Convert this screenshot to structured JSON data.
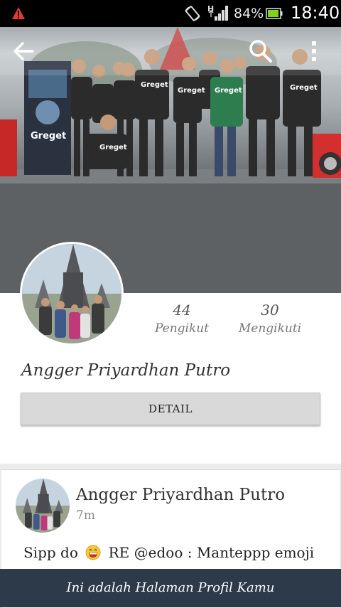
{
  "status_bar": {
    "battery_percent": "84%",
    "clock": "18:40",
    "network_type": "H",
    "icons": [
      "warning-icon",
      "screen-rotate-icon",
      "signal-icon",
      "battery-icon"
    ]
  },
  "cover": {
    "banner_text": "Greget",
    "shirt_text": "Greget",
    "icons": [
      "back-arrow-icon",
      "search-icon",
      "overflow-menu-icon"
    ]
  },
  "profile": {
    "followers_count": "44",
    "followers_label": "Pengikut",
    "following_count": "30",
    "following_label": "Mengikuti",
    "name": "Angger Priyardhan Putro",
    "detail_button": "DETAIL"
  },
  "post": {
    "author": "Angger Priyardhan Putro",
    "time": "7m",
    "text_before": "Sipp do",
    "emoji": "grinning-face-emoji",
    "text_after": "RE @edoo : Manteppp emoji"
  },
  "footer": {
    "message": "Ini adalah Halaman Profil Kamu"
  },
  "colors": {
    "footer_bg": "#2c3a4a",
    "status_bar_bg": "#000000",
    "button_bg": "#d9d9d9"
  }
}
